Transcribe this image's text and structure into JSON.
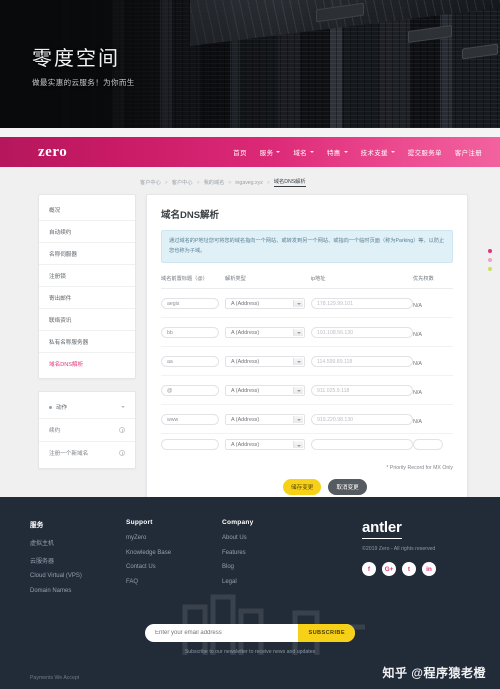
{
  "hero": {
    "title": "零度空间",
    "subtitle": "做最实惠的云服务！为你而生"
  },
  "nav": {
    "brand": "zero",
    "items": [
      {
        "label": "首页",
        "dropdown": false
      },
      {
        "label": "服务",
        "dropdown": true
      },
      {
        "label": "域名",
        "dropdown": true
      },
      {
        "label": "特惠",
        "dropdown": true
      },
      {
        "label": "技术支援",
        "dropdown": true
      },
      {
        "label": "提交服务单",
        "dropdown": false
      },
      {
        "label": "客户注册",
        "dropdown": false
      }
    ]
  },
  "breadcrumb": [
    "客户中心",
    "客户中心",
    "我的域名",
    "ingaveg.xyz",
    "域名DNS解析"
  ],
  "sidebar": {
    "items": [
      {
        "label": "概况",
        "active": false
      },
      {
        "label": "自动续约",
        "active": false
      },
      {
        "label": "名称伺服器",
        "active": false
      },
      {
        "label": "注册锁",
        "active": false
      },
      {
        "label": "寄出邮件",
        "active": false
      },
      {
        "label": "联络资讯",
        "active": false
      },
      {
        "label": "私有名称服务器",
        "active": false
      },
      {
        "label": "域名DNS解析",
        "active": true
      }
    ],
    "panel": {
      "header": "动作",
      "subitems": [
        {
          "label": "续约"
        },
        {
          "label": "注册一个新域名"
        }
      ]
    }
  },
  "main": {
    "title": "域名DNS解析",
    "notice": "通过域名的P地址您可将您的域名指向一个网站、或转发到另一个网站、或指向一个临时页面（称为Parking）等、以防止您也称为子域。",
    "table": {
      "headers": [
        "域名前置标题（@）",
        "解析类型",
        "ip地址",
        "优先权数"
      ],
      "rows": [
        {
          "host": "aegis",
          "type": "A (Address)",
          "ip": "178.129.99.101",
          "priority": "N/A"
        },
        {
          "host": "bb",
          "type": "A (Address)",
          "ip": "191.108.56.130",
          "priority": "N/A"
        },
        {
          "host": "aa",
          "type": "A (Address)",
          "ip": "114.599.89.118",
          "priority": "N/A"
        },
        {
          "host": "@",
          "type": "A (Address)",
          "ip": "911.025.9.118",
          "priority": "N/A"
        },
        {
          "host": "www",
          "type": "A (Address)",
          "ip": "919.220.98.130",
          "priority": "N/A"
        },
        {
          "host": "",
          "type": "A (Address)",
          "ip": "",
          "priority": ""
        }
      ],
      "host_placeholder": "",
      "ip_placeholder": ""
    },
    "note": "* Priority Record for MX Only",
    "buttons": {
      "save": "储存变更",
      "cancel": "取消变更"
    }
  },
  "footer": {
    "columns": [
      {
        "title": "服务",
        "links": [
          "虚拟主机",
          "云服务器",
          "Cloud Virtual (VPS)",
          "Domain Names"
        ]
      },
      {
        "title": "Support",
        "links": [
          "myZero",
          "Knowledge Base",
          "Contact Us",
          "FAQ"
        ]
      },
      {
        "title": "Company",
        "links": [
          "About Us",
          "Features",
          "Blog",
          "Legal"
        ]
      }
    ],
    "brand": "antler",
    "copyright": "©2019 Zero - All rights reserved",
    "socials": [
      "f",
      "G+",
      "t",
      "in"
    ],
    "newsletter": {
      "placeholder": "Enter your email address",
      "button": "SUBSCRIBE",
      "note": "Subscribe to our newsletter to receive news and updates"
    },
    "payments": "Payments We Accept"
  },
  "watermark": "知乎 @程序猿老橙"
}
